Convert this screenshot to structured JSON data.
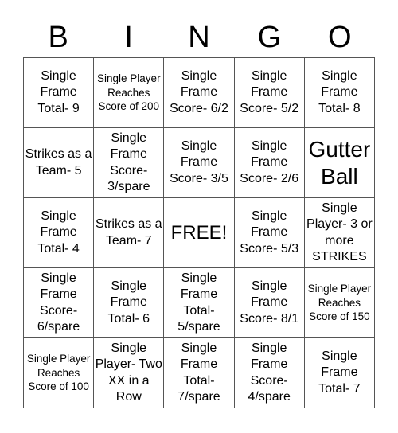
{
  "header": [
    "B",
    "I",
    "N",
    "G",
    "O"
  ],
  "cells": [
    [
      "Single Frame Total- 9",
      "Single Player Reaches Score of 200",
      "Single Frame Score- 6/2",
      "Single Frame Score- 5/2",
      "Single Frame Total- 8"
    ],
    [
      "Strikes as a Team- 5",
      "Single Frame Score- 3/spare",
      "Single Frame Score- 3/5",
      "Single Frame Score- 2/6",
      "Gutter Ball"
    ],
    [
      "Single Frame Total- 4",
      "Strikes as a Team- 7",
      "FREE!",
      "Single Frame Score- 5/3",
      "Single Player- 3 or more STRIKES"
    ],
    [
      "Single Frame Score- 6/spare",
      "Single Frame Total- 6",
      "Single Frame Total- 5/spare",
      "Single Frame Score- 8/1",
      "Single Player Reaches Score of 150"
    ],
    [
      "Single Player Reaches Score of 100",
      "Single Player- Two XX in a Row",
      "Single Frame Total- 7/spare",
      "Single Frame Score- 4/spare",
      "Single Frame Total- 7"
    ]
  ]
}
